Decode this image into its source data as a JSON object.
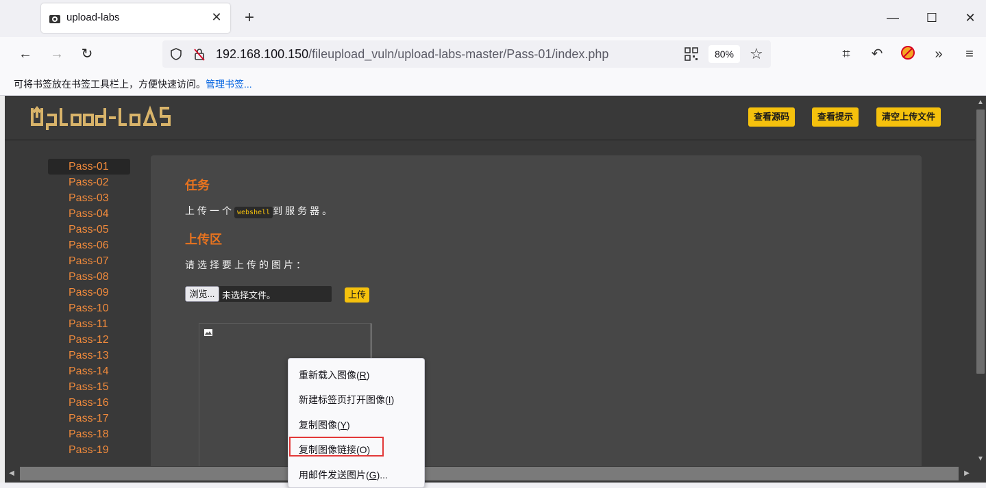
{
  "browser": {
    "tab_title": "upload-labs",
    "url_host": "192.168.100.150",
    "url_path": "/fileupload_vuln/upload-labs-master/Pass-01/index.php",
    "zoom": "80%",
    "bookmarks_hint": "可将书签放在书签工具栏上，方便快速访问。",
    "bookmarks_manage": "管理书签..."
  },
  "header": {
    "logo_text": "UpLoad-LaBS",
    "buttons": [
      "查看源码",
      "查看提示",
      "清空上传文件"
    ]
  },
  "sidebar": {
    "active": "Pass-01",
    "items": [
      "Pass-01",
      "Pass-02",
      "Pass-03",
      "Pass-04",
      "Pass-05",
      "Pass-06",
      "Pass-07",
      "Pass-08",
      "Pass-09",
      "Pass-10",
      "Pass-11",
      "Pass-12",
      "Pass-13",
      "Pass-14",
      "Pass-15",
      "Pass-16",
      "Pass-17",
      "Pass-18",
      "Pass-19"
    ]
  },
  "main": {
    "task_title": "任务",
    "task_prefix": "上传一个",
    "task_code": "webshell",
    "task_suffix": "到服务器。",
    "upload_title": "上传区",
    "upload_prompt": "请选择要上传的图片：",
    "browse_label": "浏览...",
    "no_file": "未选择文件。",
    "upload_button": "上传"
  },
  "context_menu": {
    "items": [
      {
        "label": "重新载入图像(",
        "key": "R",
        "end": ")"
      },
      {
        "label": "新建标签页打开图像(",
        "key": "I",
        "end": ")"
      },
      {
        "label": "复制图像(",
        "key": "Y",
        "end": ")"
      },
      {
        "label": "复制图像链接(O)",
        "key": "",
        "end": ""
      },
      {
        "label": "用邮件发送图片(",
        "key": "G",
        "end": ")..."
      }
    ]
  },
  "colors": {
    "accent_yellow": "#f5c10d",
    "accent_orange": "#e8731f",
    "page_bg": "#393939",
    "highlight_red": "#e23838"
  }
}
